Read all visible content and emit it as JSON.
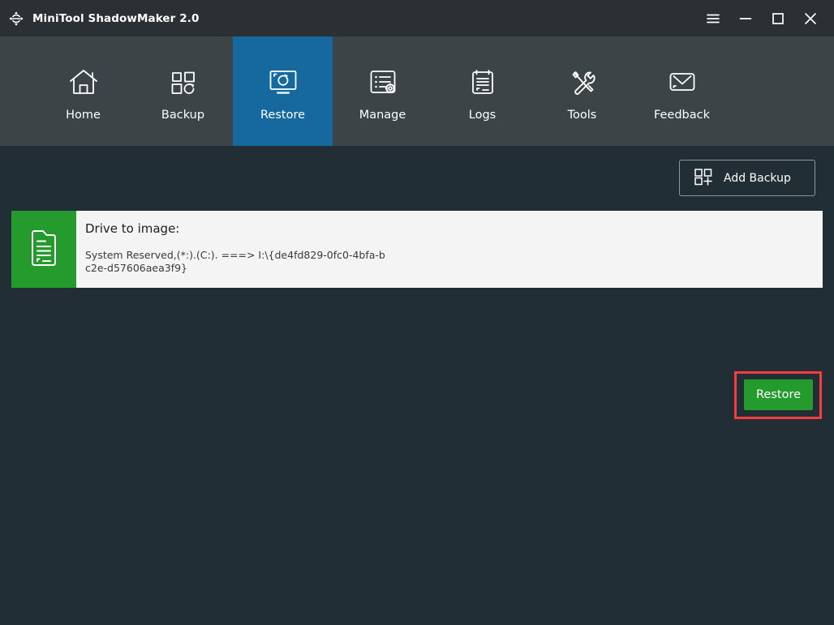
{
  "window": {
    "title": "MiniTool ShadowMaker 2.0",
    "app_icon": "restore-arrows-icon",
    "controls": [
      {
        "name": "menu-button",
        "icon": "hamburger-menu-icon",
        "label": "Menu"
      },
      {
        "name": "minimize-button",
        "icon": "minimize-icon",
        "label": "Minimize"
      },
      {
        "name": "maximize-button",
        "icon": "maximize-icon",
        "label": "Maximize"
      },
      {
        "name": "close-button",
        "icon": "close-icon",
        "label": "Close"
      }
    ]
  },
  "nav": {
    "active": "Restore",
    "items": [
      {
        "label": "Home",
        "icon": "home-icon"
      },
      {
        "label": "Backup",
        "icon": "backup-squares-refresh-icon"
      },
      {
        "label": "Restore",
        "icon": "monitor-restore-icon"
      },
      {
        "label": "Manage",
        "icon": "list-gear-icon"
      },
      {
        "label": "Logs",
        "icon": "clipboard-icon"
      },
      {
        "label": "Tools",
        "icon": "wrench-screwdriver-icon"
      },
      {
        "label": "Feedback",
        "icon": "envelope-icon"
      }
    ]
  },
  "toolbar": {
    "add_backup_label": "Add Backup",
    "add_backup_icon": "add-squares-plus-icon"
  },
  "backup_card": {
    "thumb_icon": "document-image-icon",
    "title": "Drive to image:",
    "path": " System Reserved,(*:).(C:). ===> I:\\{de4fd829-0fc0-4bfa-bc2e-d57606aea3f9}",
    "restore_label": "Restore"
  },
  "colors": {
    "titlebar": "#2b3034",
    "navbar": "#3c4448",
    "active_tab": "#16699f",
    "body": "#222e35",
    "card": "#f4f4f4",
    "green": "#259b2e",
    "highlight": "#fa3c3c"
  }
}
